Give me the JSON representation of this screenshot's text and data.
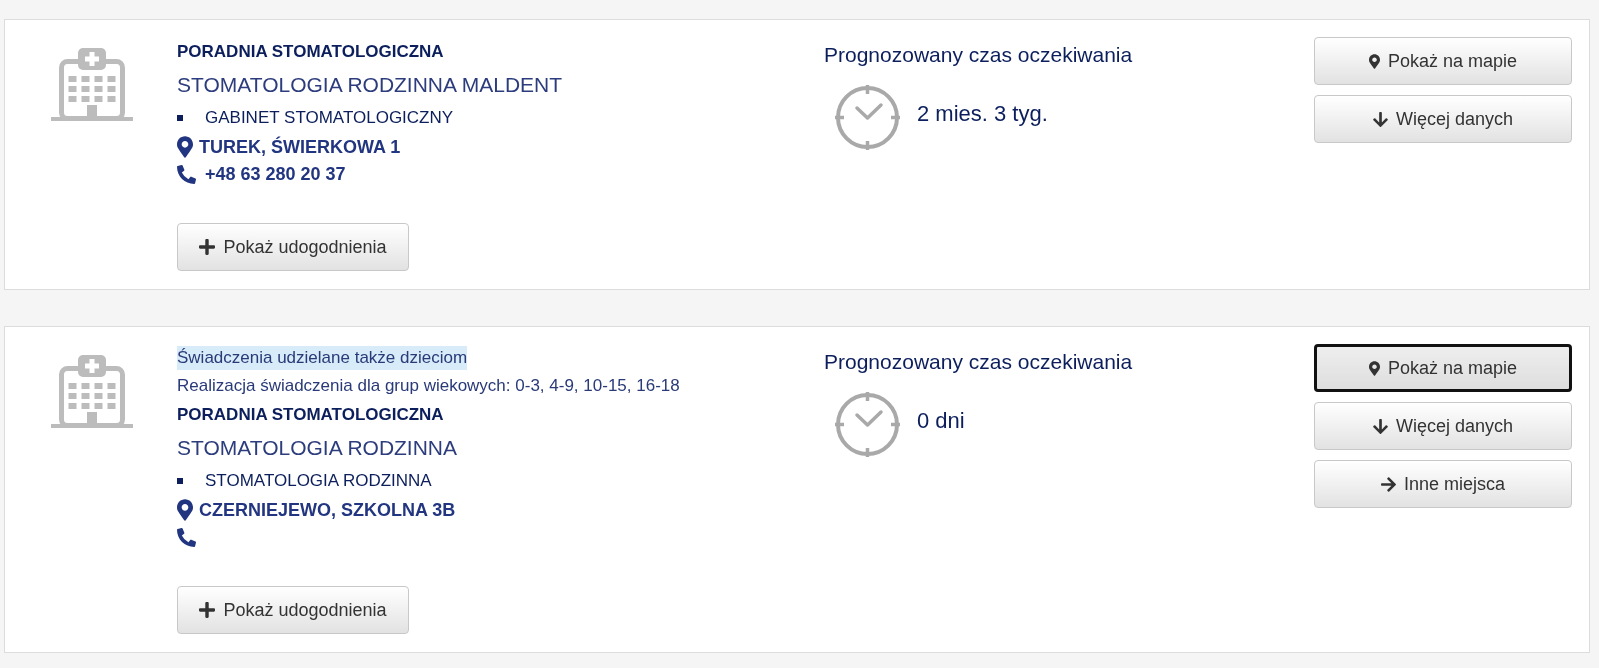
{
  "results": [
    {
      "category": "PORADNIA STOMATOLOGICZNA",
      "name": "STOMATOLOGIA RODZINNA MALDENT",
      "services": [
        "GABINET STOMATOLOGICZNY"
      ],
      "address": "TUREK, ŚWIERKOWA 1",
      "phone": "+48 63 280 20 37",
      "amenities_button": {
        "label": "Pokaż udogodnienia"
      },
      "wait": {
        "heading": "Prognozowany czas oczekiwania",
        "value": "2 mies. 3 tyg."
      },
      "actions": [
        {
          "kind": "map",
          "label": "Pokaż na mapie",
          "focused": false
        },
        {
          "kind": "more",
          "label": "Więcej danych",
          "focused": false
        }
      ]
    },
    {
      "notes": [
        {
          "text": "Świadczenia udzielane także dzieciom",
          "highlighted": true
        },
        {
          "text": "Realizacja świadczenia dla grup wiekowych: 0-3, 4-9, 10-15, 16-18",
          "highlighted": false
        }
      ],
      "category": "PORADNIA STOMATOLOGICZNA",
      "name": "STOMATOLOGIA RODZINNA",
      "services": [
        "STOMATOLOGIA RODZINNA"
      ],
      "address": "CZERNIEJEWO, SZKOLNA 3B",
      "amenities_button": {
        "label": "Pokaż udogodnienia"
      },
      "wait": {
        "heading": "Prognozowany czas oczekiwania",
        "value": "0 dni"
      },
      "actions": [
        {
          "kind": "map",
          "label": "Pokaż na mapie",
          "focused": true
        },
        {
          "kind": "more",
          "label": "Więcej danych",
          "focused": false
        },
        {
          "kind": "other",
          "label": "Inne miejsca",
          "focused": false
        }
      ]
    }
  ]
}
